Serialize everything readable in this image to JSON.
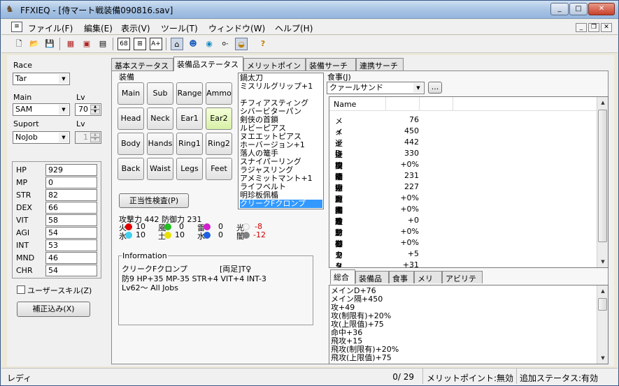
{
  "window": {
    "title": "FFXIEQ - [侍マート戦装備090816.sav]",
    "minimize": "_",
    "maximize": "□",
    "close": "✕"
  },
  "menu": [
    "ファイル(F)",
    "編集(E)",
    "表示(V)",
    "ツール(T)",
    "ウィンドウ(W)",
    "ヘルプ(H)"
  ],
  "toolbar": {
    "b1": "68",
    "b2": "A+",
    "b3": "o-"
  },
  "left": {
    "race_label": "Race",
    "race_value": "Tar",
    "main_label": "Main",
    "main_value": "SAM",
    "lv_label": "Lv",
    "lv_value": "70",
    "support_label": "Suport",
    "support_value": "NoJob",
    "sub_lv_label": "Lv",
    "sub_lv_value": "1",
    "stats": [
      {
        "k": "HP",
        "v": "929"
      },
      {
        "k": "MP",
        "v": "0"
      },
      {
        "k": "STR",
        "v": "82"
      },
      {
        "k": "DEX",
        "v": "66"
      },
      {
        "k": "VIT",
        "v": "58"
      },
      {
        "k": "AGI",
        "v": "54"
      },
      {
        "k": "INT",
        "v": "53"
      },
      {
        "k": "MND",
        "v": "46"
      },
      {
        "k": "CHR",
        "v": "54"
      }
    ],
    "user_skill": "ユーザースキル(Z)",
    "correct_btn": "補正込み(X)"
  },
  "tabs": [
    "基本ステータス",
    "装備品ステータス",
    "メリットポイント",
    "装備サーチ",
    "連携サーチ"
  ],
  "equip": {
    "group_label": "装備",
    "slots": [
      "Main",
      "Sub",
      "Range",
      "Ammo",
      "Head",
      "Neck",
      "Ear1",
      "Ear2",
      "Body",
      "Hands",
      "Ring1",
      "Ring2",
      "Back",
      "Waist",
      "Legs",
      "Feet"
    ],
    "validate_btn": "正当性検査(P)",
    "atk_def": "攻撃力 442 防御力 231",
    "elements": [
      {
        "name": "火",
        "val": "10",
        "color": "#e00000"
      },
      {
        "name": "風",
        "val": "0",
        "color": "#20c020"
      },
      {
        "name": "雷",
        "val": "0",
        "color": "#d020d0"
      },
      {
        "name": "光",
        "val": "-8",
        "color": "#f4f4f4"
      },
      {
        "name": "氷",
        "val": "10",
        "color": "#40d0f0"
      },
      {
        "name": "土",
        "val": "10",
        "color": "#e8e000"
      },
      {
        "name": "水",
        "val": "0",
        "color": "#2060e0"
      },
      {
        "name": "闇",
        "val": "-12",
        "color": "#808080"
      }
    ],
    "list": [
      "鍋太刀",
      "ミスリルグリップ+1",
      "",
      "チフィアスティング",
      "シバービターパン",
      "剣侠の首鎖",
      "ルビーピアス",
      "ヌエエットピアス",
      "ホーバージョン+1",
      "落人の篭手",
      "スナイパーリング",
      "ラジャスリング",
      "アメミットマント+1",
      "ライフベルト",
      "明珍板佩楯",
      "クリークFクロンプ"
    ],
    "selected_index": 15,
    "info_label": "Information",
    "info_name": "クリークFクロンプ",
    "info_tag": "[両足]T♀",
    "info_line1": "防9 HP+35 MP-35 STR+4 VIT+4 INT-3",
    "info_line2": "Lv62～ All Jobs"
  },
  "food": {
    "label": "食事(J)",
    "value": "クァールサンド",
    "more": "..."
  },
  "stats_list": {
    "header": "Name",
    "rows": [
      {
        "n": "メインD",
        "v": "76"
      },
      {
        "n": "メイン間隔",
        "v": "450"
      },
      {
        "n": "近接攻撃力",
        "v": "442"
      },
      {
        "n": "近接命中力",
        "v": "330"
      },
      {
        "n": "クリット率",
        "v": "+0%"
      },
      {
        "n": "物理防御力",
        "v": "231"
      },
      {
        "n": "物理回避力",
        "v": "227"
      },
      {
        "n": "魔法攻撃力",
        "v": "+0%"
      },
      {
        "n": "魔法防御力",
        "v": "+0%"
      },
      {
        "n": "敵対心",
        "v": "+0"
      },
      {
        "n": "クリット率",
        "v": "+0%"
      },
      {
        "n": "被クリット率",
        "v": "+0%"
      },
      {
        "n": "モクシャ",
        "v": "+5"
      },
      {
        "n": "ストアTP",
        "v": "+31"
      }
    ]
  },
  "sub_tabs": [
    "総合",
    "装備品",
    "食事",
    "メリポ",
    "アビリティ"
  ],
  "summary": [
    "メインD+76",
    "メイン隔+450",
    "攻+49",
    "攻(制限有)+20%",
    "攻(上限值)+75",
    "命中+36",
    "飛攻+15",
    "飛攻(制限有)+20%",
    "飛攻(上限值)+75"
  ],
  "status": {
    "left": "レディ",
    "count": "0/  29",
    "merit": "メリットポイント:無効",
    "extra": "追加ステータス:有効"
  }
}
